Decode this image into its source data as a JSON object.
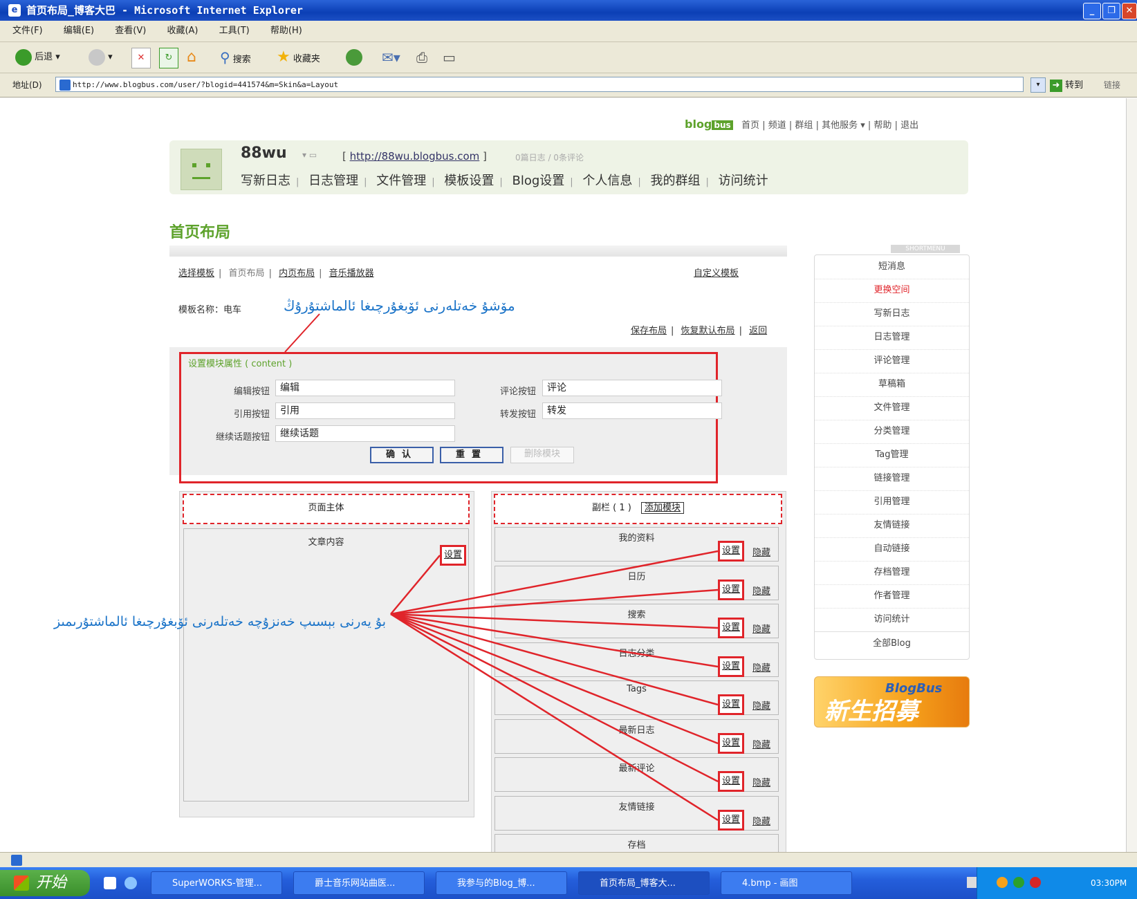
{
  "window": {
    "title": "首页布局_博客大巴 - Microsoft Internet Explorer",
    "menus": [
      "文件(F)",
      "编辑(E)",
      "查看(V)",
      "收藏(A)",
      "工具(T)",
      "帮助(H)"
    ],
    "toolbar": {
      "back": "后退",
      "search": "搜索",
      "favorites": "收藏夹"
    },
    "address_label": "地址(D)",
    "address": "http://www.blogbus.com/user/?blogid=441574&m=Skin&a=Layout",
    "go": "转到",
    "links": "链接"
  },
  "taskbar": {
    "start": "开始",
    "items": [
      "SuperWORKS-管理...",
      "爵士音乐网站曲医...",
      "我参与的Blog_博...",
      "首页布局_博客大...",
      "4.bmp - 画图"
    ],
    "clock": "03:30PM"
  },
  "site": {
    "logo": "blog",
    "logo_badge": "bus",
    "topnav": [
      "首页",
      "频道",
      "群组",
      "其他服务",
      "帮助",
      "退出"
    ]
  },
  "blog": {
    "name": "88wu",
    "url": "http://88wu.blogbus.com",
    "stats": "0篇日志 / 0条评论",
    "nav": [
      "写新日志",
      "日志管理",
      "文件管理",
      "模板设置",
      "Blog设置",
      "个人信息",
      "我的群组",
      "访问统计"
    ]
  },
  "page": {
    "title": "首页布局",
    "subnav": {
      "select_template": "选择模板",
      "home_layout": "首页布局",
      "inner_layout": "内页布局",
      "music_player": "音乐播放器"
    },
    "template_manage": "自定义模板",
    "template_name_label": "模板名称：电车",
    "actions": [
      "保存布局",
      "恢复默认布局",
      "返回"
    ]
  },
  "settings": {
    "title": "设置模块属性 ( content )",
    "fields": [
      {
        "label": "编辑按钮",
        "value": "编辑"
      },
      {
        "label": "评论按钮",
        "value": "评论"
      },
      {
        "label": "引用按钮",
        "value": "引用"
      },
      {
        "label": "转发按钮",
        "value": "转发"
      },
      {
        "label": "继续话题按钮",
        "value": "继续话题"
      }
    ],
    "confirm": "确认",
    "reset": "重置",
    "delete": "删除模块"
  },
  "layout": {
    "main_title": "页面主体",
    "main_module": "文章内容",
    "side_title": "副栏 ( 1 )",
    "add_module": "添加模块",
    "set": "设置",
    "hide": "隐藏",
    "modules": [
      "我的资料",
      "日历",
      "搜索",
      "日志分类",
      "Tags",
      "最新日志",
      "最新评论",
      "友情链接",
      "存档"
    ]
  },
  "annotations": {
    "top": "مۆشۇ خەتلەرنى ئۆبغۇرچىغا ئالماشتۇرۇڭ",
    "left": "بۇ يەرنى بېسىپ خەنزۇچە خەتلەرنى ئۆبغۇرچىغا ئالماشتۇرىمىز"
  },
  "sidebar": {
    "tag": "SHORTMENU",
    "items": [
      "短消息",
      "更换空间",
      "写新日志",
      "日志管理",
      "评论管理",
      "草稿箱",
      "文件管理",
      "分类管理",
      "Tag管理",
      "链接管理",
      "引用管理",
      "友情链接",
      "自动链接",
      "存档管理",
      "作者管理",
      "访问统计",
      "全部Blog"
    ],
    "banner_title": "BlogBus",
    "banner_text": "新生招募"
  },
  "colors": {
    "accent_green": "#5da22b",
    "annotation_red": "#e0242a",
    "annotation_blue": "#1a73c8"
  }
}
